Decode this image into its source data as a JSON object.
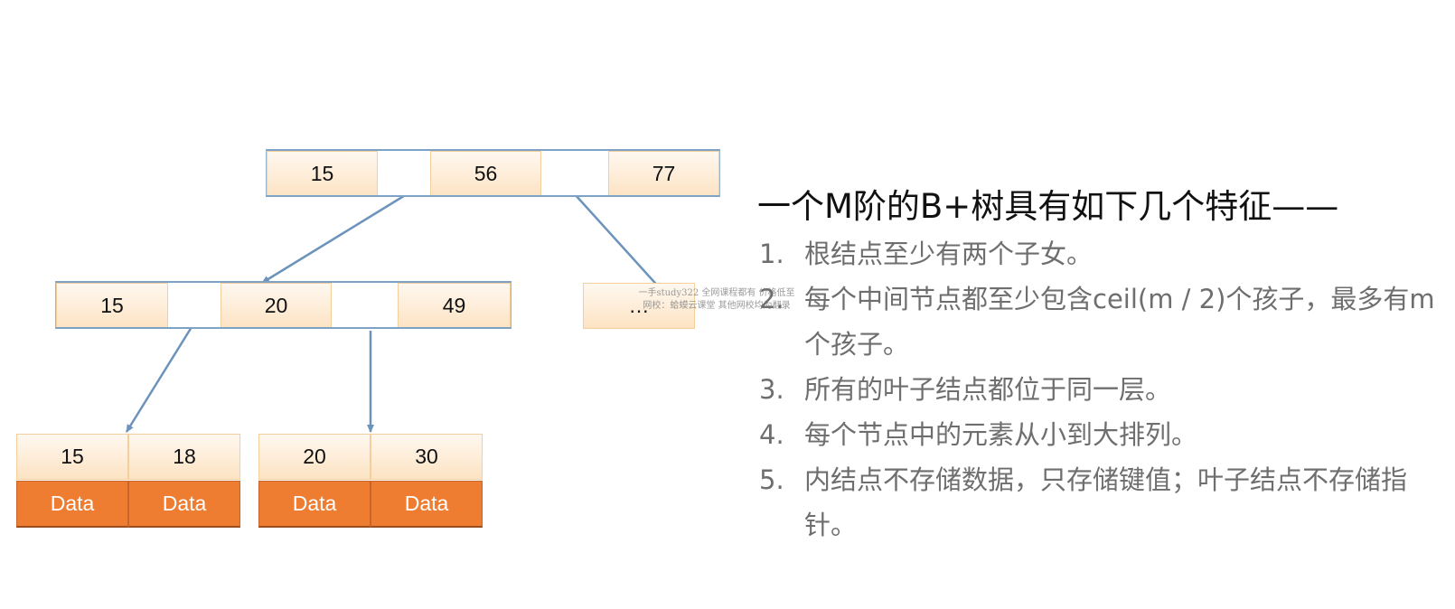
{
  "diagram": {
    "root": {
      "keys": [
        "15",
        "56",
        "77"
      ]
    },
    "level2_left": {
      "keys": [
        "15",
        "20",
        "49"
      ]
    },
    "level2_right": {
      "label": "…"
    },
    "leaf_left": {
      "keys": [
        "15",
        "18"
      ],
      "data": [
        "Data",
        "Data"
      ]
    },
    "leaf_right": {
      "keys": [
        "20",
        "30"
      ],
      "data": [
        "Data",
        "Data"
      ]
    },
    "colors": {
      "arrow": "#6c93bb",
      "data_fill": "#ee7d31",
      "key_fill": "#fde3c3"
    }
  },
  "watermark": {
    "line1": "一手study322 全网课程都有 价格低至",
    "line2": "网校：蛤蟆云课堂 其他网校均为翻录"
  },
  "features": {
    "title": "一个M阶的B+树具有如下几个特征——",
    "items": [
      {
        "num": "1.",
        "text": "根结点至少有两个子女。"
      },
      {
        "num": "2.",
        "text": "每个中间节点都至少包含ceil(m / 2)个孩子，最多有m个孩子。"
      },
      {
        "num": "3.",
        "text": "所有的叶子结点都位于同一层。"
      },
      {
        "num": "4.",
        "text": "每个节点中的元素从小到大排列。"
      },
      {
        "num": "5.",
        "text": "内结点不存储数据，只存储键值；叶子结点不存储指针。"
      }
    ]
  }
}
